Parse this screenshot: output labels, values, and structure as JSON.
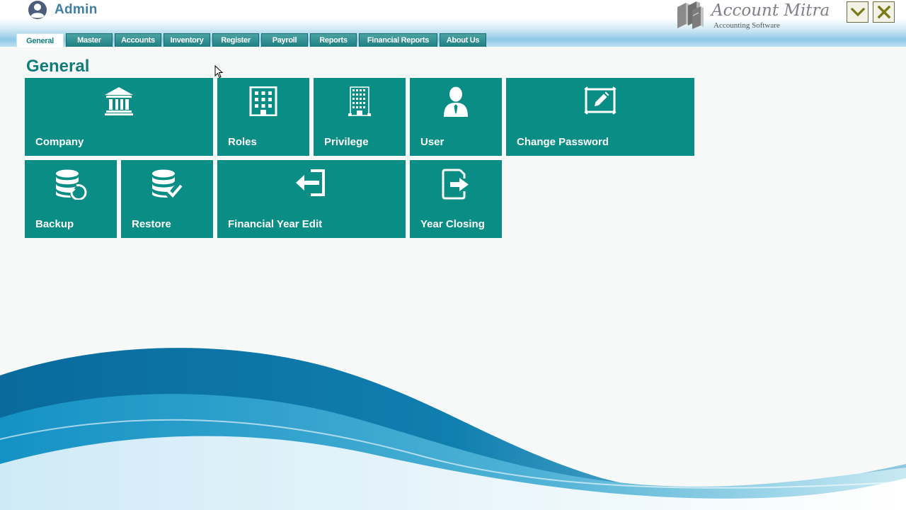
{
  "header": {
    "user": {
      "name": "Admin",
      "icon": "user-circle-icon"
    },
    "brand": {
      "title": "Account Mitra",
      "subtitle": "Accounting Software",
      "icon": "books-icon"
    },
    "window_controls": [
      {
        "name": "minimize",
        "icon": "chevron-down-icon",
        "color": "#7a7a17"
      },
      {
        "name": "close",
        "icon": "close-icon",
        "color": "#7a7a17"
      }
    ]
  },
  "tabs": [
    {
      "label": "General",
      "active": true
    },
    {
      "label": "Master"
    },
    {
      "label": "Accounts"
    },
    {
      "label": "Inventory"
    },
    {
      "label": "Register"
    },
    {
      "label": "Payroll"
    },
    {
      "label": "Reports"
    },
    {
      "label": "Financial Reports"
    },
    {
      "label": "About Us"
    }
  ],
  "section": {
    "title": "General"
  },
  "tiles": [
    {
      "label": "Company",
      "icon": "bank-icon"
    },
    {
      "label": "Roles",
      "icon": "building-icon"
    },
    {
      "label": "Privilege",
      "icon": "tower-icon"
    },
    {
      "label": "User",
      "icon": "person-icon"
    },
    {
      "label": "Change Password",
      "icon": "edit-frame-icon"
    },
    {
      "label": "Backup",
      "icon": "database-refresh-icon"
    },
    {
      "label": "Restore",
      "icon": "database-check-icon"
    },
    {
      "label": "Financial Year Edit",
      "icon": "sign-in-icon"
    },
    {
      "label": "Year Closing",
      "icon": "file-export-icon"
    }
  ],
  "colors": {
    "tile": "#0a8d85",
    "tab": "#2a8a8c",
    "title": "#117c7c",
    "username": "#3f7fa4",
    "wave_dark": "#0b6fa0",
    "wave_light": "#8fd0ec"
  }
}
